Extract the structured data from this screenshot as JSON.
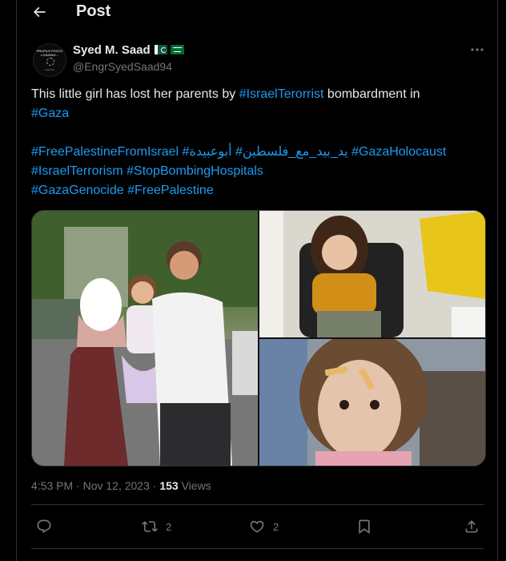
{
  "header": {
    "title": "Post"
  },
  "author": {
    "display_name": "Syed M. Saad",
    "handle": "@EngrSyedSaad94",
    "avatar_text": "PROFILE PHOTO LOADING...",
    "avatar_small": "Saad Mir"
  },
  "tweet": {
    "line1_plain": "This little girl has lost her parents by ",
    "line1_tag": "#IsraelTerorrist",
    "line1_end": " bombardment in",
    "line2_tag": "#Gaza",
    "tags_line1": [
      "#FreePalestineFromIsrael",
      "#أبوعبيدة",
      "#يد_بيد_مع_فلسطين",
      "#GazaHolocaust"
    ],
    "tags_line2": [
      "#IsraelTerrorism",
      "#StopBombingHospitals"
    ],
    "tags_line3": [
      "#GazaGenocide",
      "#FreePalestine"
    ]
  },
  "meta": {
    "time": "4:53 PM",
    "sep1": "·",
    "date": "Nov 12, 2023",
    "sep2": "·",
    "views_count": "153",
    "views_label": "Views"
  },
  "actions": {
    "reply_count": "",
    "retweet_count": "2",
    "like_count": "2"
  },
  "icons": [
    "back-arrow-icon",
    "more-icon",
    "reply-icon",
    "retweet-icon",
    "like-icon",
    "bookmark-icon",
    "share-icon"
  ],
  "colors": {
    "background": "#000000",
    "text": "#e7e9ea",
    "secondary": "#71767b",
    "link": "#1d9bf0",
    "border": "#2f3336"
  }
}
